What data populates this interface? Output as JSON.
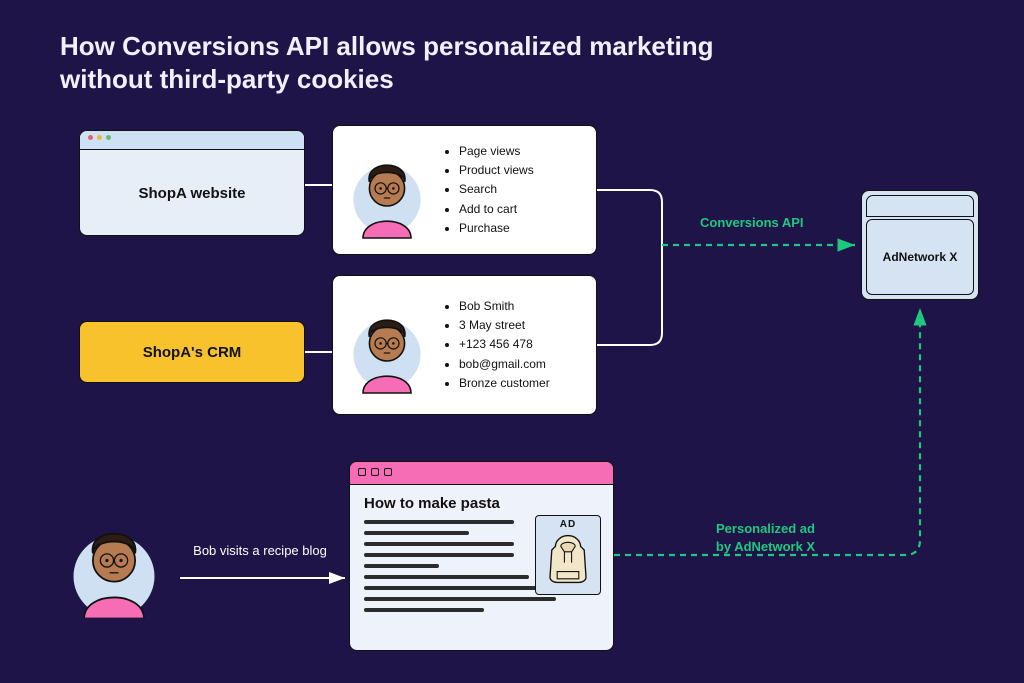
{
  "title_line1": "How Conversions API allows personalized marketing",
  "title_line2": "without third-party cookies",
  "shopa_website_label": "ShopA website",
  "shopa_crm_label": "ShopA's CRM",
  "events": {
    "i0": "Page views",
    "i1": "Product views",
    "i2": "Search",
    "i3": "Add to cart",
    "i4": "Purchase"
  },
  "crm": {
    "i0": "Bob Smith",
    "i1": "3 May street",
    "i2": "+123 456 478",
    "i3": "bob@gmail.com",
    "i4": "Bronze customer"
  },
  "conversions_api_label": "Conversions API",
  "adnetwork_label": "AdNetwork X",
  "bob_visits_label": "Bob visits a recipe blog",
  "blog_title": "How to make pasta",
  "ad_label": "AD",
  "personalized_ad_line1": "Personalized ad",
  "personalized_ad_line2": "by AdNetwork X"
}
